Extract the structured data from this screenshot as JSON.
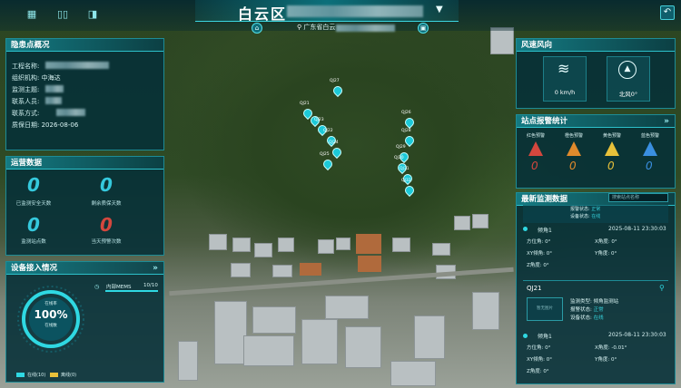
{
  "header": {
    "title": "白云区",
    "location": "广东省白云",
    "left_icons": [
      "grid-icon",
      "split-icon",
      "collapse-icon"
    ],
    "back_icon": "back-arrow-icon"
  },
  "hazard_overview": {
    "title": "隐患点概况",
    "fields": [
      {
        "label": "工程名称:",
        "value": ""
      },
      {
        "label": "组织机构:",
        "value": "中海达"
      },
      {
        "label": "监测主题:",
        "value": ""
      },
      {
        "label": "联系人员:",
        "value": ""
      },
      {
        "label": "联系方式:",
        "value": ""
      },
      {
        "label": "质保日期:",
        "value": "2026-08-06"
      }
    ]
  },
  "ops_data": {
    "title": "运营数据",
    "stats": [
      {
        "value": "0",
        "label": "已监测安全天数",
        "color": "#35c9dd"
      },
      {
        "value": "0",
        "label": "剩余质保天数",
        "color": "#35c9dd"
      },
      {
        "value": "0",
        "label": "监测站点数",
        "color": "#35c9dd"
      },
      {
        "value": "0",
        "label": "当天预警次数",
        "color": "#d4473e"
      }
    ]
  },
  "device_access": {
    "title": "设备接入情况",
    "percent": "100%",
    "ring_label_top": "在线率",
    "ring_label_bottom": "在线数",
    "device_name": "内部MEMS",
    "device_count": "10/10",
    "legend": [
      {
        "label": "在线(10)",
        "color": "#2fd8e2"
      },
      {
        "label": "离线(0)",
        "color": "#e8c13a"
      }
    ]
  },
  "wind": {
    "title": "风速风向",
    "speed": "0 km/h",
    "direction": "北风0°"
  },
  "alarm_stats": {
    "title": "站点报警统计",
    "levels": [
      {
        "label": "红色预警",
        "value": "0",
        "color": "#d4473e"
      },
      {
        "label": "橙色预警",
        "value": "0",
        "color": "#e08a2c"
      },
      {
        "label": "黄色预警",
        "value": "0",
        "color": "#e8c13a"
      },
      {
        "label": "蓝色预警",
        "value": "0",
        "color": "#3a8fe0"
      }
    ]
  },
  "latest_data": {
    "title": "最新监测数据",
    "search_placeholder": "搜索站点名称",
    "top_card": {
      "lines": [
        {
          "label": "报警状态:",
          "value": "正常"
        },
        {
          "label": "设备状态:",
          "value": "在线"
        }
      ]
    },
    "reading_1": {
      "name": "倾角1",
      "time": "2025-08-11 23:30:03",
      "rows": [
        [
          "方位角: 0°",
          "X角度: 0°"
        ],
        [
          "XY倾角: 0°",
          "Y角度: 0°"
        ],
        [
          "Z角度: 0°",
          ""
        ]
      ]
    },
    "station": {
      "id": "QJ21",
      "type_label": "监测类型:",
      "type_value": "倾角监测站",
      "alarm_label": "报警状态:",
      "alarm_value": "正常",
      "device_label": "设备状态:",
      "device_value": "在线",
      "thumb_label": "暂无图片"
    },
    "reading_2": {
      "name": "倾角1",
      "time": "2025-08-11 23:30:03",
      "rows": [
        [
          "方位角: 0°",
          "X角度: -0.01°"
        ],
        [
          "XY倾角: 0°",
          "Y角度: 0°"
        ],
        [
          "Z角度: 0°",
          ""
        ]
      ]
    }
  },
  "map_pins": [
    {
      "label": "QJ27"
    },
    {
      "label": "QJ21"
    },
    {
      "label": "QJ23"
    },
    {
      "label": "QJ22"
    },
    {
      "label": "QJ24"
    },
    {
      "label": "QJ25"
    },
    {
      "label": "QJ26"
    },
    {
      "label": "QJ28"
    },
    {
      "label": "QJ29"
    },
    {
      "label": "QJ30"
    },
    {
      "label": "QJ31"
    },
    {
      "label": "QJ32"
    }
  ]
}
